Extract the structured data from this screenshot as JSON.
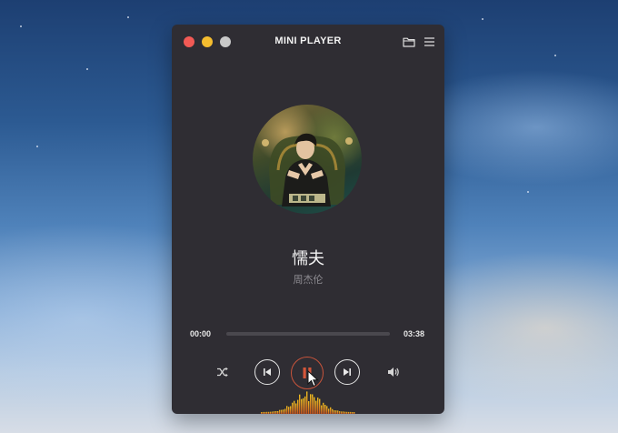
{
  "window": {
    "title": "MINI PLAYER"
  },
  "track": {
    "title": "懦夫",
    "artist": "周杰伦"
  },
  "playback": {
    "current_time": "00:00",
    "duration": "03:38",
    "progress": 0
  },
  "controls": {
    "shuffle_icon": "shuffle-icon",
    "prev_icon": "skip-previous-icon",
    "play_state_icon": "pause-icon",
    "next_icon": "skip-next-icon",
    "volume_icon": "volume-icon",
    "folder_icon": "folder-icon",
    "menu_icon": "menu-icon"
  },
  "colors": {
    "window_bg": "#2f2d33",
    "accent": "#c8543b",
    "close": "#f25a55",
    "minimize": "#f5bd2f",
    "zoom": "#c9c9c9",
    "visualizer_top": "#f0c020",
    "visualizer_bottom": "#c8541f"
  }
}
